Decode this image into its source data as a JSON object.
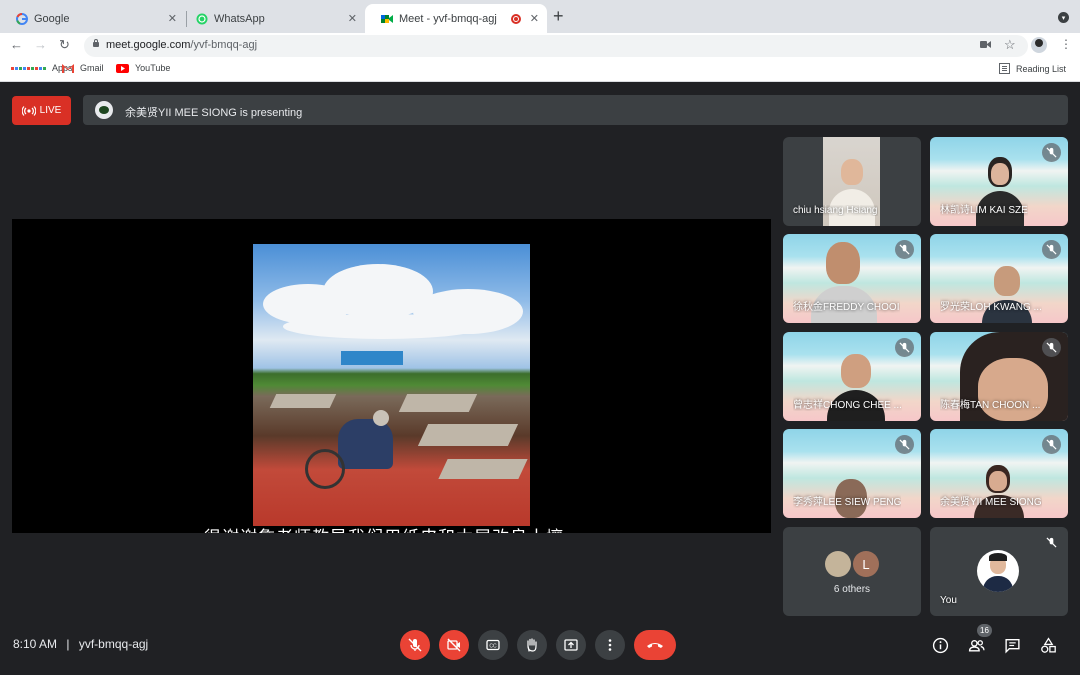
{
  "tabs": [
    {
      "title": "Google",
      "icon": "google-icon"
    },
    {
      "title": "WhatsApp",
      "icon": "whatsapp-icon"
    },
    {
      "title": "Meet - yvf-bmqq-agj",
      "icon": "meet-icon",
      "active": true
    }
  ],
  "address": {
    "host": "meet.google.com",
    "path": "/yvf-bmqq-agj"
  },
  "bookmarks": [
    {
      "label": "Apps",
      "icon": "apps-grid-icon"
    },
    {
      "label": "Gmail",
      "icon": "gmail-icon"
    },
    {
      "label": "YouTube",
      "icon": "youtube-icon"
    }
  ],
  "reading_list": "Reading List",
  "meeting": {
    "live_label": "LIVE",
    "presenting_text": "余美贤YII MEE SIONG is presenting",
    "caption": "很谢谢詹老师教导我们用纸皮和木屑改良土壤",
    "time": "8:10 AM",
    "separator": "|",
    "code": "yvf-bmqq-agj",
    "participant_count": "16"
  },
  "participants": [
    {
      "name": "chiu hsiang Hsiang",
      "muted": false
    },
    {
      "name": "林凯诗LIM KAI SZE",
      "muted": true
    },
    {
      "name": "徐秋金FREDDY CHOOI",
      "muted": true
    },
    {
      "name": "罗光荣LOH KWANG ...",
      "muted": true
    },
    {
      "name": "曾志祥CHONG CHEE ...",
      "muted": true
    },
    {
      "name": "陈春梅TAN CHOON ...",
      "muted": true
    },
    {
      "name": "李秀萍LEE SIEW PENG",
      "muted": true
    },
    {
      "name": "余美贤YII MEE SIONG",
      "muted": true
    }
  ],
  "others": {
    "label": "6 others",
    "avatar_letter": "L"
  },
  "self": {
    "label": "You",
    "muted": true
  },
  "colors": {
    "live": "#d93025",
    "end_call": "#ea4335",
    "background": "#202124",
    "tile": "#3c4043"
  }
}
